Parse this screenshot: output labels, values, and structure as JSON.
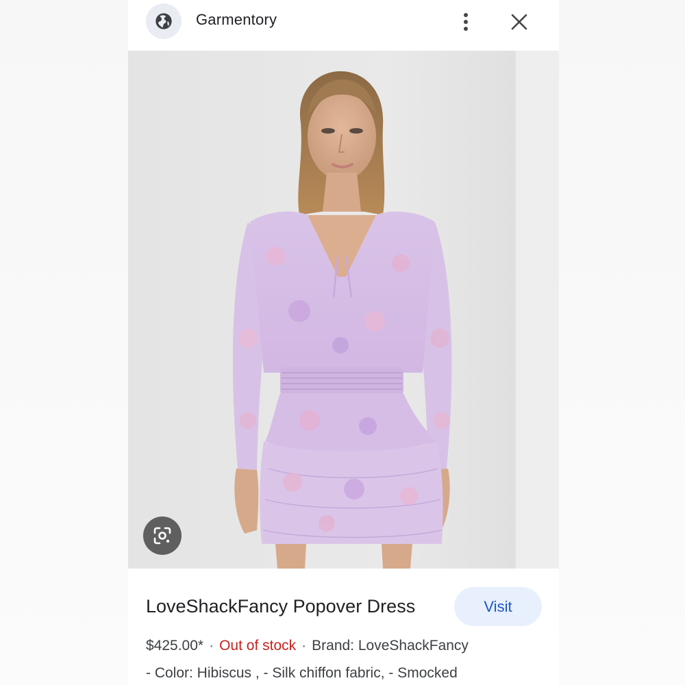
{
  "header": {
    "site_name": "Garmentory",
    "site_icon": "globe-icon",
    "more_icon": "more-vert-icon",
    "close_icon": "close-icon"
  },
  "image": {
    "alt": "Model wearing a lilac floral chiffon popover dress",
    "lens_icon": "google-lens-icon"
  },
  "product": {
    "title": "LoveShackFancy Popover Dress",
    "visit_label": "Visit",
    "price": "$425.00*",
    "stock_status": "Out of stock",
    "brand": "Brand: LoveShackFancy",
    "description": "- Color: Hibiscus , - Silk chiffon fabric, - Smocked"
  },
  "colors": {
    "stock_red": "#c5221f",
    "visit_blue": "#1a56c4",
    "visit_bg": "#e8f0fe",
    "dress_lilac": "#d7bde6"
  }
}
